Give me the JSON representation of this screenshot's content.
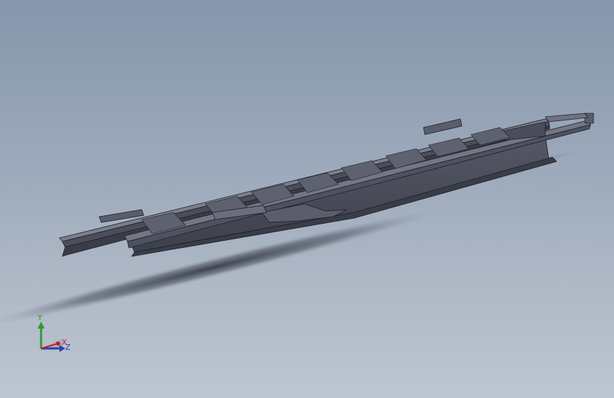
{
  "viewport": {
    "background_top": "#8796ab",
    "background_bottom": "#bdc5d0"
  },
  "model": {
    "icon": "chassis-frame-model",
    "body_color": "#4a4d5a",
    "edge_color": "#1c1e26",
    "highlight_color": "#7a7e8c"
  },
  "triad": {
    "icon": "coordinate-triad-icon",
    "y_label": "Y",
    "x_label": "X",
    "z_label": "Z",
    "y_color": "#2f9a2f",
    "x_color": "#c62020",
    "z_color": "#2a3fb0"
  }
}
